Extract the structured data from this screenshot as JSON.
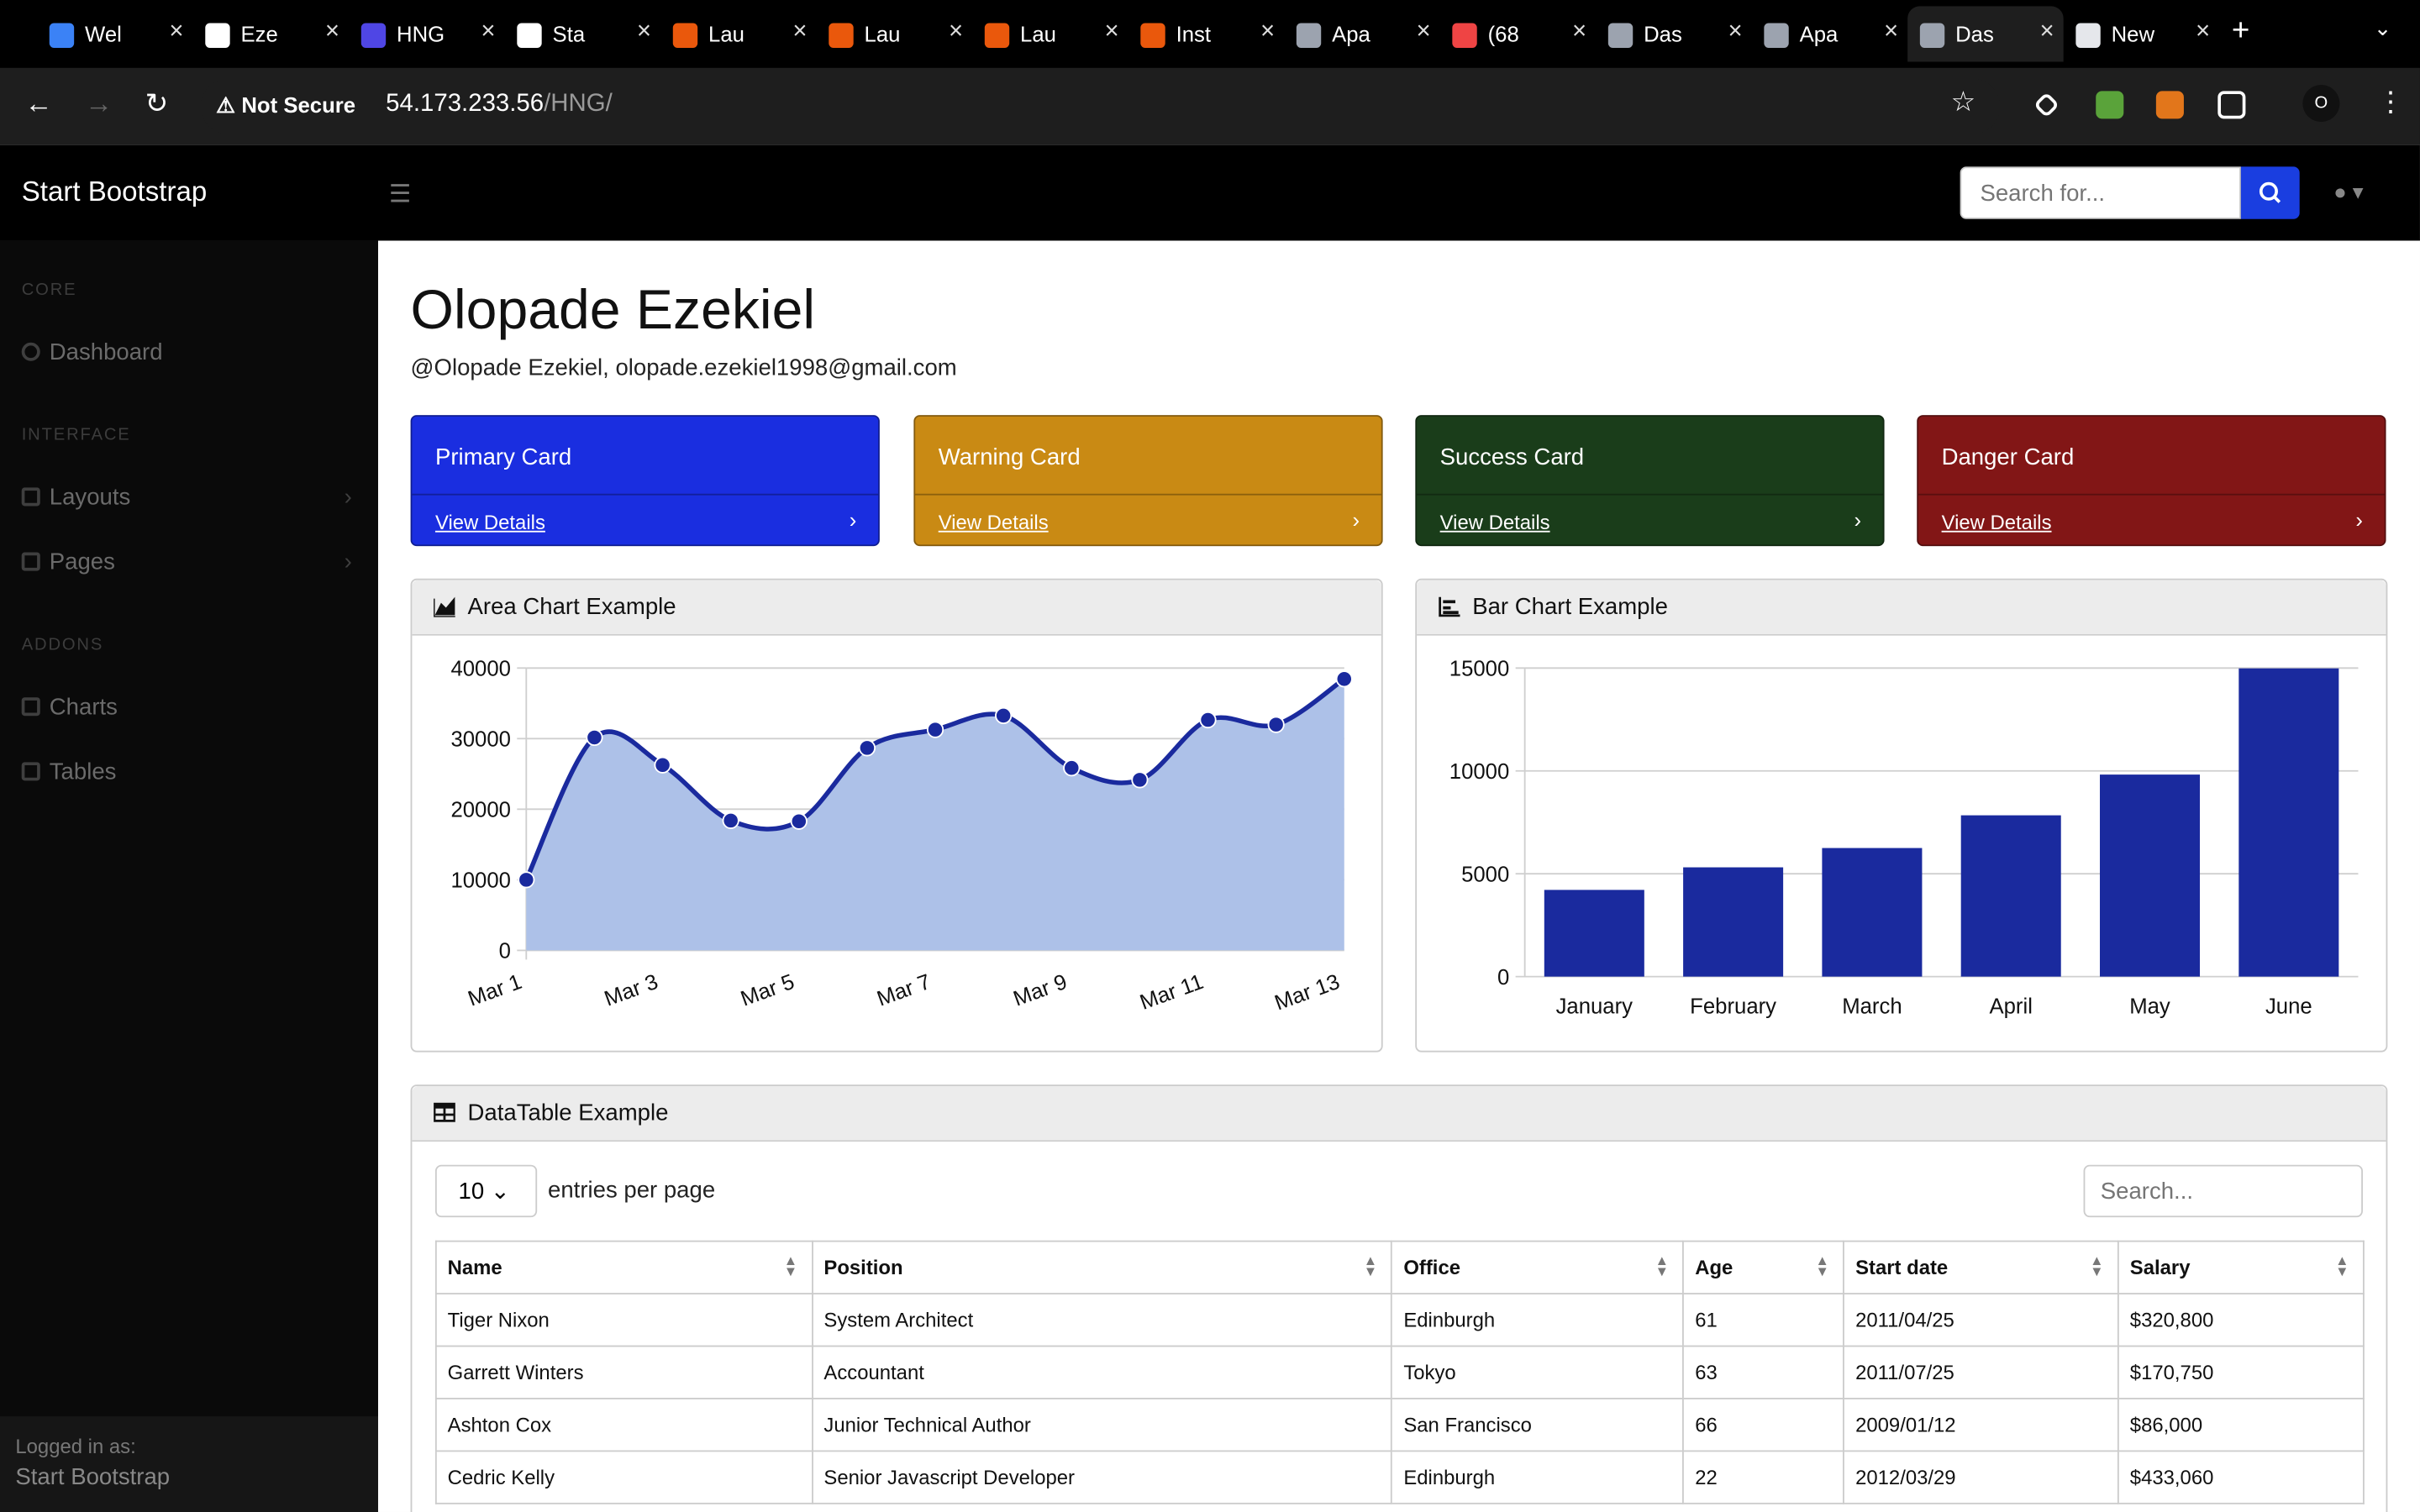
{
  "browser": {
    "tabs": [
      {
        "label": "Wel",
        "icon": "vscode-icon",
        "color": "#3b82f6"
      },
      {
        "label": "Eze",
        "icon": "github-icon",
        "color": "#ffffff"
      },
      {
        "label": "HNG",
        "icon": "list-icon",
        "color": "#4f46e5"
      },
      {
        "label": "Sta",
        "icon": "openai-icon",
        "color": "#ffffff"
      },
      {
        "label": "Lau",
        "icon": "launch-icon",
        "color": "#ea580c"
      },
      {
        "label": "Lau",
        "icon": "launch-icon",
        "color": "#ea580c"
      },
      {
        "label": "Lau",
        "icon": "launch-icon",
        "color": "#ea580c"
      },
      {
        "label": "Inst",
        "icon": "launch-icon",
        "color": "#ea580c"
      },
      {
        "label": "Apa",
        "icon": "globe-icon",
        "color": "#9ca3af"
      },
      {
        "label": "(68",
        "icon": "youtube-icon",
        "color": "#ef4444"
      },
      {
        "label": "Das",
        "icon": "globe-icon",
        "color": "#9ca3af"
      },
      {
        "label": "Apa",
        "icon": "globe-icon",
        "color": "#9ca3af"
      },
      {
        "label": "Das",
        "icon": "globe-icon",
        "color": "#9ca3af"
      },
      {
        "label": "New",
        "icon": "chrome-icon",
        "color": "#e5e7eb"
      }
    ],
    "active_tab": 12,
    "security_label": "Not Secure",
    "url_host": "54.173.233.56",
    "url_path": "/HNG/",
    "profile_initial": "O"
  },
  "navbar": {
    "brand": "Start Bootstrap",
    "search_placeholder": "Search for...",
    "accent": "#1a3ee0"
  },
  "sidebar": {
    "sections": [
      {
        "heading": "CORE",
        "items": [
          {
            "label": "Dashboard",
            "icon": "dashboard-icon"
          }
        ]
      },
      {
        "heading": "INTERFACE",
        "items": [
          {
            "label": "Layouts",
            "icon": "columns-icon"
          },
          {
            "label": "Pages",
            "icon": "book-icon"
          }
        ]
      },
      {
        "heading": "ADDONS",
        "items": [
          {
            "label": "Charts",
            "icon": "chart-icon"
          },
          {
            "label": "Tables",
            "icon": "table-icon"
          }
        ]
      }
    ],
    "footer_label": "Logged in as:",
    "footer_user": "Start Bootstrap"
  },
  "main": {
    "title": "Olopade Ezekiel",
    "subtitle": "@Olopade Ezekiel, olopade.ezekiel1998@gmail.com",
    "cards": [
      {
        "title": "Primary Card",
        "link": "View Details",
        "color": "#1a2ee0"
      },
      {
        "title": "Warning Card",
        "link": "View Details",
        "color": "#c98a14"
      },
      {
        "title": "Success Card",
        "link": "View Details",
        "color": "#1a3d1a"
      },
      {
        "title": "Danger Card",
        "link": "View Details",
        "color": "#821616"
      }
    ],
    "area_chart_title": "Area Chart Example",
    "bar_chart_title": "Bar Chart Example",
    "table_title": "DataTable Example",
    "entries_value": "10",
    "entries_label": "entries per page",
    "table_search_placeholder": "Search...",
    "table": {
      "headers": [
        "Name",
        "Position",
        "Office",
        "Age",
        "Start date",
        "Salary"
      ],
      "rows": [
        [
          "Tiger Nixon",
          "System Architect",
          "Edinburgh",
          "61",
          "2011/04/25",
          "$320,800"
        ],
        [
          "Garrett Winters",
          "Accountant",
          "Tokyo",
          "63",
          "2011/07/25",
          "$170,750"
        ],
        [
          "Ashton Cox",
          "Junior Technical Author",
          "San Francisco",
          "66",
          "2009/01/12",
          "$86,000"
        ],
        [
          "Cedric Kelly",
          "Senior Javascript Developer",
          "Edinburgh",
          "22",
          "2012/03/29",
          "$433,060"
        ]
      ]
    }
  },
  "chart_data": [
    {
      "type": "area",
      "title": "Area Chart Example",
      "categories": [
        "Mar 1",
        "Mar 2",
        "Mar 3",
        "Mar 4",
        "Mar 5",
        "Mar 6",
        "Mar 7",
        "Mar 8",
        "Mar 9",
        "Mar 10",
        "Mar 11",
        "Mar 12",
        "Mar 13"
      ],
      "x_tick_labels": [
        "Mar 1",
        "Mar 3",
        "Mar 5",
        "Mar 7",
        "Mar 9",
        "Mar 11",
        "Mar 13"
      ],
      "values": [
        10000,
        30162,
        26263,
        18394,
        18287,
        28682,
        31274,
        33259,
        25849,
        24159,
        32651,
        31984,
        38451
      ],
      "ylim": [
        0,
        40000
      ],
      "yticks": [
        0,
        10000,
        20000,
        30000,
        40000
      ],
      "grid": true,
      "line_color": "#1a2a9e",
      "fill_color": "#adc1e8"
    },
    {
      "type": "bar",
      "title": "Bar Chart Example",
      "categories": [
        "January",
        "February",
        "March",
        "April",
        "May",
        "June"
      ],
      "values": [
        4215,
        5312,
        6251,
        7841,
        9821,
        14984
      ],
      "ylim": [
        0,
        15000
      ],
      "yticks": [
        0,
        5000,
        10000,
        15000
      ],
      "grid": true,
      "bar_color": "#1a2a9e"
    }
  ]
}
